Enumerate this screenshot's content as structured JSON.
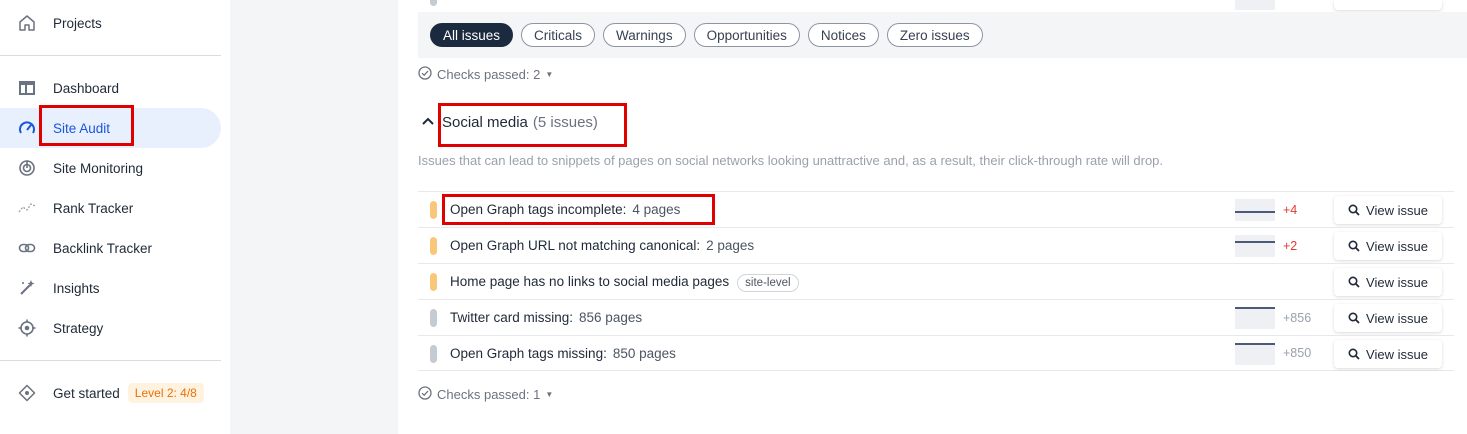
{
  "sidebar": {
    "projects": "Projects",
    "items": [
      {
        "label": "Dashboard",
        "icon": "dashboard-icon"
      },
      {
        "label": "Site Audit",
        "icon": "site-audit-icon"
      },
      {
        "label": "Site Monitoring",
        "icon": "site-monitoring-icon"
      },
      {
        "label": "Rank Tracker",
        "icon": "rank-tracker-icon"
      },
      {
        "label": "Backlink Tracker",
        "icon": "backlink-icon"
      },
      {
        "label": "Insights",
        "icon": "insights-icon"
      },
      {
        "label": "Strategy",
        "icon": "strategy-icon"
      }
    ],
    "get_started": "Get started",
    "level_badge": "Level 2: 4/8"
  },
  "filters": [
    "All issues",
    "Criticals",
    "Warnings",
    "Opportunities",
    "Notices",
    "Zero issues"
  ],
  "checks_top": "Checks passed: 2",
  "section": {
    "title": "Social media",
    "count": "(5 issues)",
    "description": "Issues that can lead to snippets of pages on social networks looking unattractive and, as a result, their click-through rate will drop."
  },
  "issues": [
    {
      "name": "Open Graph tags incomplete:",
      "pages": "4 pages",
      "severity": "warning",
      "delta": "+4"
    },
    {
      "name": "Open Graph URL not matching canonical:",
      "pages": "2 pages",
      "severity": "warning",
      "delta": "+2"
    },
    {
      "name": "Home page has no links to social media pages",
      "tag": "site-level",
      "severity": "warning"
    },
    {
      "name": "Twitter card missing:",
      "pages": "856 pages",
      "severity": "notice",
      "delta": "+856"
    },
    {
      "name": "Open Graph tags missing:",
      "pages": "850 pages",
      "severity": "notice",
      "delta": "+850"
    }
  ],
  "view_issue_label": "View issue",
  "checks_bottom": "Checks passed: 1",
  "colors": {
    "accent": "#1a56db",
    "highlight": "#e00000",
    "warning": "#f9c779",
    "notice": "#c5cbd3"
  }
}
